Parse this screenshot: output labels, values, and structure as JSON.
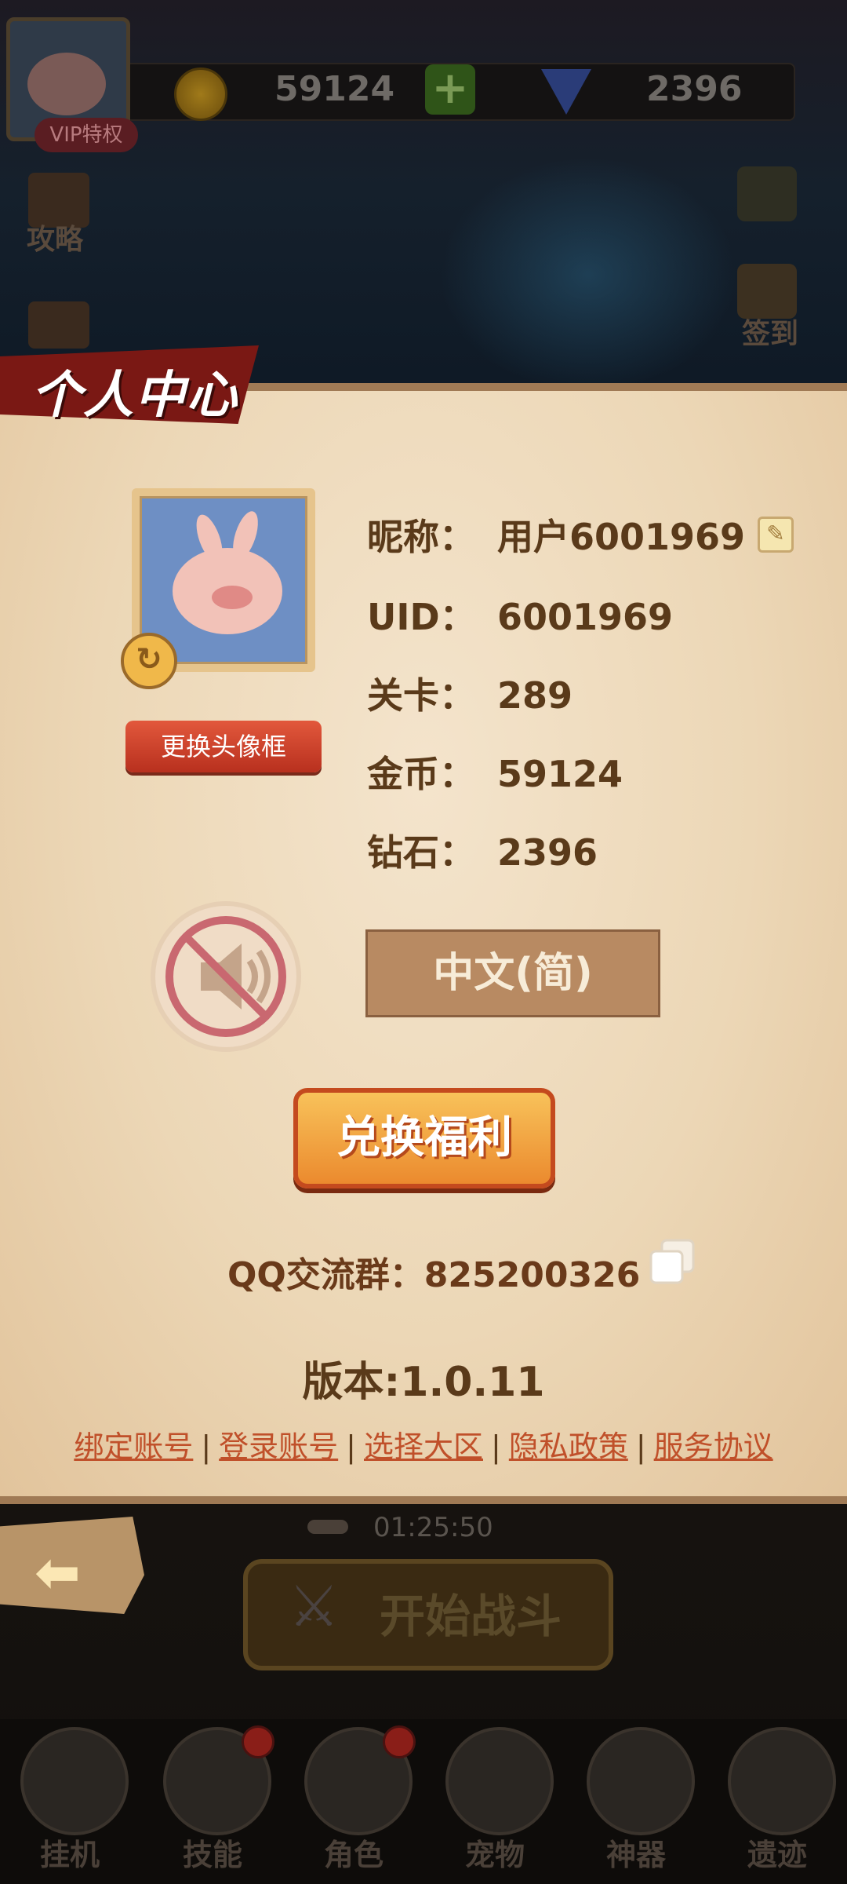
{
  "topbar": {
    "vip_label": "VIP特权",
    "coins": "59124",
    "plus": "+",
    "diamonds": "2396"
  },
  "side": {
    "guide_label": "攻略",
    "checkin_label": "签到"
  },
  "panel": {
    "title": "个人中心",
    "change_frame_label": "更换头像框",
    "rows": [
      {
        "label": "昵称：",
        "value": "用户6001969"
      },
      {
        "label": "UID：",
        "value": "6001969"
      },
      {
        "label": "关卡：",
        "value": "289"
      },
      {
        "label": "金币：",
        "value": "59124"
      },
      {
        "label": "钻石：",
        "value": "2396"
      }
    ],
    "language_label": "中文(简)",
    "redeem_label": "兑换福利",
    "qq_group": "QQ交流群：825200326",
    "version": "版本:1.0.11",
    "links": [
      "绑定账号",
      "登录账号",
      "选择大区",
      "隐私政策",
      "服务协议"
    ]
  },
  "bottom": {
    "timer": "01:25:50",
    "battle_label": "开始战斗",
    "nav": [
      "挂机",
      "技能",
      "角色",
      "宠物",
      "神器",
      "遗迹"
    ]
  },
  "colors": {
    "accent_red": "#7a1814",
    "parchment": "#ecd7b6",
    "link": "#c0502a",
    "redeem": "#eb8a2e"
  },
  "icons": [
    "refresh-icon",
    "edit-icon",
    "sound-muted-icon",
    "copy-icon",
    "back-arrow-icon",
    "swords-icon",
    "coin-icon",
    "diamond-icon"
  ]
}
